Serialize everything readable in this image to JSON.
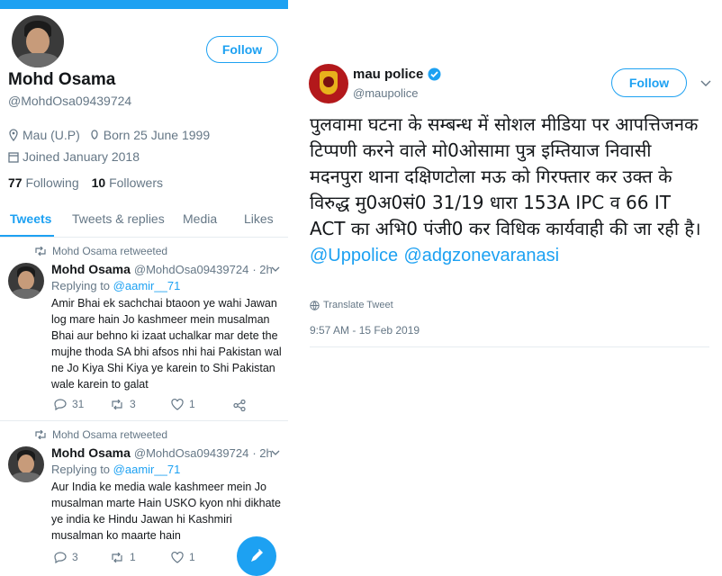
{
  "profile": {
    "name": "Mohd Osama",
    "handle": "@MohdOsa09439724",
    "follow_label": "Follow",
    "location": "Mau (U.P)",
    "birth": "Born 25 June 1999",
    "joined": "Joined January 2018",
    "following_count": "77",
    "following_label": "Following",
    "followers_count": "10",
    "followers_label": "Followers"
  },
  "tabs": [
    {
      "label": "Tweets"
    },
    {
      "label": "Tweets & replies"
    },
    {
      "label": "Media"
    },
    {
      "label": "Likes"
    }
  ],
  "timeline": [
    {
      "retweet_label": "Mohd Osama retweeted",
      "name": "Mohd Osama",
      "handle": "@MohdOsa09439724",
      "time": "· 2h",
      "replying_prefix": "Replying to",
      "replying_to": "@aamir__71",
      "text": "Amir Bhai ek sachchai btaoon ye wahi Jawan log mare hain Jo kashmeer mein musalman Bhai aur behno ki izaat uchalkar mar dete the mujhe thoda SA bhi afsos nhi hai Pakistan wal ne Jo Kiya Shi Kiya ye karein to Shi Pakistan wale karein to galat",
      "replies": "31",
      "retweets": "3",
      "likes": "1"
    },
    {
      "retweet_label": "Mohd Osama retweeted",
      "name": "Mohd Osama",
      "handle": "@MohdOsa09439724",
      "time": "· 2h",
      "replying_prefix": "Replying to",
      "replying_to": "@aamir__71",
      "text": "Aur India ke media wale kashmeer mein Jo musalman marte Hain USKO kyon nhi dikhate ye india ke Hindu Jawan hi Kashmiri musalman ko maarte hain",
      "replies": "3",
      "retweets": "1",
      "likes": "1"
    }
  ],
  "police_tweet": {
    "name": "mau police",
    "handle": "@maupolice",
    "follow_label": "Follow",
    "text": "पुलवामा घटना के सम्बन्ध में सोशल मीडिया पर आपत्तिजनक टिप्पणी करने वाले मो0ओसामा पुत्र इम्तियाज निवासी मदनपुरा थाना दक्षिणटोला मऊ को गिरफ्तार कर उक्त के विरुद्ध मु0अ0सं0 31/19 धारा 153A IPC व 66 IT ACT का अभि0 पंजी0 कर विधिक कार्यवाही की जा रही है।",
    "mention1": "@Uppolice",
    "mention2": "@adgzonevaranasi",
    "translate": "Translate Tweet",
    "timestamp": "9:57 AM - 15 Feb 2019"
  },
  "colors": {
    "accent": "#1da1f2",
    "muted": "#657786",
    "text": "#14171a",
    "verified": "#1da1f2"
  },
  "icons": [
    "location-icon",
    "birthday-icon",
    "calendar-icon",
    "retweet-icon",
    "reply-icon",
    "like-icon",
    "share-icon",
    "verified-icon",
    "chevron-down-icon",
    "compose-icon",
    "globe-icon"
  ]
}
